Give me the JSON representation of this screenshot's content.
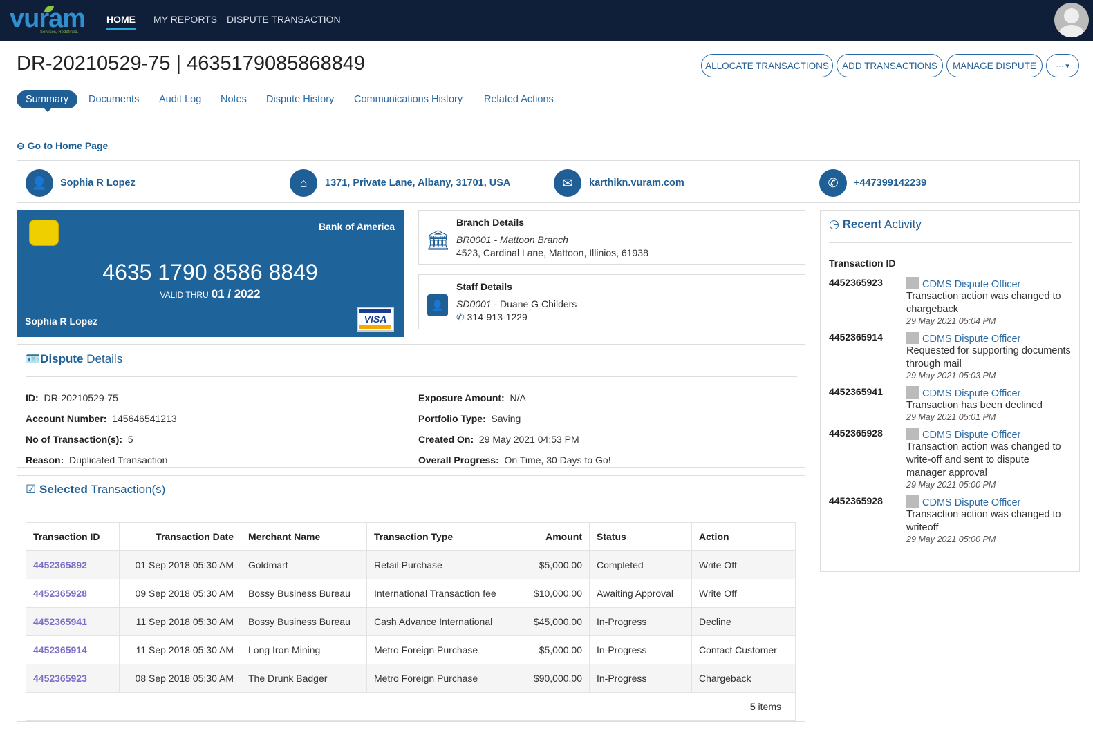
{
  "nav": {
    "logo": "vuram",
    "logo_tagline": "Services, Redefined.",
    "items": [
      "HOME",
      "MY REPORTS",
      "DISPUTE TRANSACTION"
    ]
  },
  "header": {
    "title": "DR-20210529-75 | 4635179085868849",
    "buttons": [
      "ALLOCATE TRANSACTIONS",
      "ADD TRANSACTIONS",
      "MANAGE DISPUTE",
      "··· ▾"
    ]
  },
  "tabs": [
    "Summary",
    "Documents",
    "Audit Log",
    "Notes",
    "Dispute History",
    "Communications History",
    "Related Actions"
  ],
  "home_link": "Go to Home Page",
  "contact": {
    "name": "Sophia R Lopez",
    "address": "1371, Private Lane, Albany, 31701, USA",
    "email": "karthikn.vuram.com",
    "phone": "+447399142239"
  },
  "card": {
    "bank": "Bank of America",
    "number": "4635 1790 8586 8849",
    "valid_label": "VALID THRU",
    "valid": "01 / 2022",
    "holder": "Sophia R Lopez",
    "brand": "VISA"
  },
  "branch": {
    "title": "Branch Details",
    "code": "BR0001 - Mattoon Branch",
    "address": "4523, Cardinal Lane, Mattoon, Illinios, 61938"
  },
  "staff": {
    "title": "Staff Details",
    "code": "SD0001",
    "name": " - Duane  G Childers",
    "phone": "314-913-1229"
  },
  "dispute": {
    "title_bold": "Dispute",
    "title_rest": " Details",
    "left": [
      {
        "label": "ID:",
        "value": "DR-20210529-75"
      },
      {
        "label": "Account Number:",
        "value": "145646541213"
      },
      {
        "label": "No of Transaction(s):",
        "value": "5"
      },
      {
        "label": "Reason:",
        "value": "Duplicated Transaction"
      }
    ],
    "right": [
      {
        "label": "Exposure Amount:",
        "value": "N/A"
      },
      {
        "label": "Portfolio Type:",
        "value": "Saving"
      },
      {
        "label": "Created On:",
        "value": "29 May 2021 04:53 PM"
      },
      {
        "label": "Overall Progress:",
        "value": "On Time, 30 Days to Go!"
      }
    ]
  },
  "transactions": {
    "title_bold": "Selected",
    "title_rest": " Transaction(s)",
    "columns": [
      "Transaction ID",
      "Transaction Date",
      "Merchant Name",
      "Transaction Type",
      "Amount",
      "Status",
      "Action"
    ],
    "rows": [
      [
        "4452365892",
        "01 Sep 2018 05:30 AM",
        "Goldmart",
        "Retail Purchase",
        "$5,000.00",
        "Completed",
        "Write Off"
      ],
      [
        "4452365928",
        "09 Sep 2018 05:30 AM",
        "Bossy Business Bureau",
        "International Transaction fee",
        "$10,000.00",
        "Awaiting Approval",
        "Write Off"
      ],
      [
        "4452365941",
        "11 Sep 2018 05:30 AM",
        "Bossy Business Bureau",
        "Cash Advance International",
        "$45,000.00",
        "In-Progress",
        "Decline"
      ],
      [
        "4452365914",
        "11 Sep 2018 05:30 AM",
        "Long Iron Mining",
        "Metro Foreign Purchase",
        "$5,000.00",
        "In-Progress",
        "Contact Customer"
      ],
      [
        "4452365923",
        "08 Sep 2018 05:30 AM",
        "The Drunk Badger",
        "Metro Foreign Purchase",
        "$90,000.00",
        "In-Progress",
        "Chargeback"
      ]
    ],
    "count": "5",
    "count_label": " items"
  },
  "activity": {
    "title_bold": "Recent",
    "title_rest": " Activity",
    "column": "Transaction ID",
    "items": [
      {
        "id": "4452365923",
        "who": "CDMS Dispute Officer",
        "msg": "Transaction action was changed to chargeback",
        "when": "29 May 2021 05:04 PM"
      },
      {
        "id": "4452365914",
        "who": "CDMS Dispute Officer",
        "msg": "Requested for supporting documents through mail",
        "when": "29 May 2021 05:03 PM"
      },
      {
        "id": "4452365941",
        "who": "CDMS Dispute Officer",
        "msg": "Transaction has been declined",
        "when": "29 May 2021 05:01 PM"
      },
      {
        "id": "4452365928",
        "who": "CDMS Dispute Officer",
        "msg": "Transaction action was changed to write-off and sent to dispute manager approval",
        "when": "29 May 2021 05:00 PM"
      },
      {
        "id": "4452365928",
        "who": "CDMS Dispute Officer",
        "msg": "Transaction action was changed to writeoff",
        "when": "29 May 2021 05:00 PM"
      }
    ]
  }
}
